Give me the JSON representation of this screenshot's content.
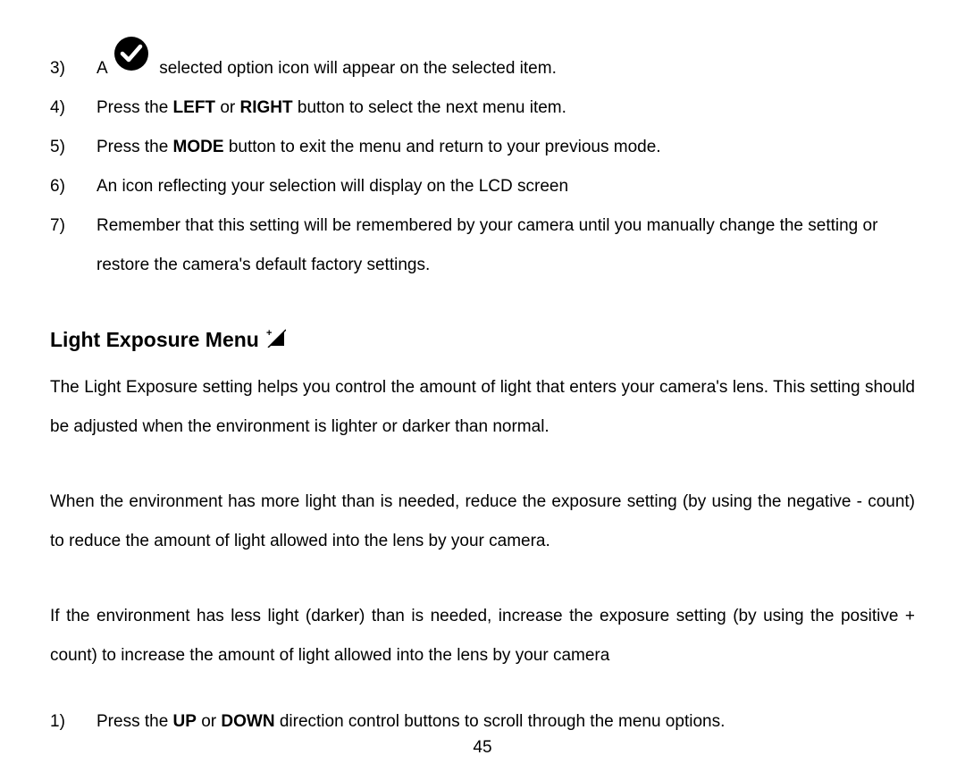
{
  "list1": {
    "item3": {
      "num": "3)",
      "prefix": "A ",
      "suffix": "selected option icon will appear on the selected item."
    },
    "item4": {
      "num": "4)",
      "t1": "Press the ",
      "b1": "LEFT",
      "t2": " or ",
      "b2": "RIGHT",
      "t3": " button to select the next menu item."
    },
    "item5": {
      "num": "5)",
      "t1": "Press the ",
      "b1": "MODE",
      "t2": " button to exit the menu and return to your previous mode."
    },
    "item6": {
      "num": "6)",
      "text": "An icon reflecting your selection will display on the LCD screen"
    },
    "item7": {
      "num": "7)",
      "text": "Remember that this setting will be remembered by your camera until you manually change the setting or restore the camera's default factory settings."
    }
  },
  "heading": "Light Exposure Menu",
  "paragraphs": {
    "p1": "The Light Exposure setting helps you control the amount of light that enters your camera's lens. This setting should be adjusted when the environment is lighter or darker than normal.",
    "p2": "When the environment has more light than is needed, reduce the exposure setting (by using the negative - count) to reduce the amount of light allowed into the lens by your camera.",
    "p3": "If the environment has less light (darker) than is needed, increase the exposure setting (by using the positive + count) to increase the amount of light allowed into the lens by your camera"
  },
  "list2": {
    "item1": {
      "num": "1)",
      "t1": "Press the ",
      "b1": "UP",
      "t2": " or ",
      "b2": "DOWN",
      "t3": " direction control buttons to scroll through the menu options."
    }
  },
  "page_number": "45"
}
